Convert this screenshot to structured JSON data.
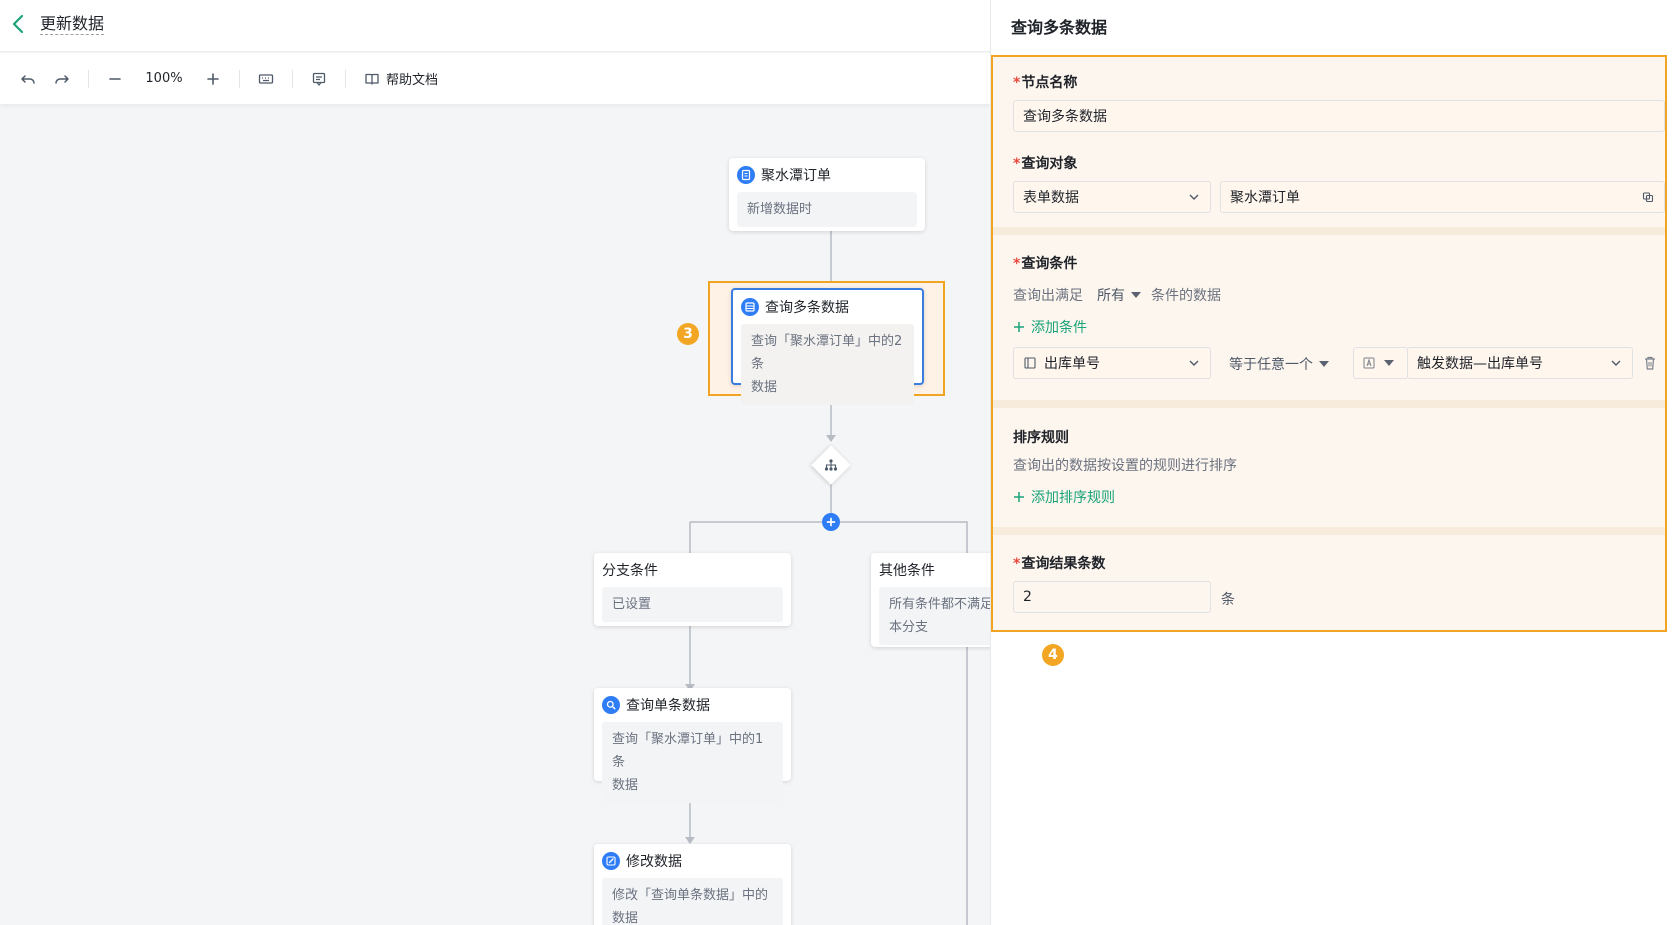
{
  "header": {
    "title": "更新数据"
  },
  "toolbar": {
    "zoom": "100%",
    "help_label": "帮助文档"
  },
  "colors": {
    "accent_blue": "#2f7df6",
    "highlight_orange": "#f0a422",
    "link_green": "#1aa37a",
    "required_red": "#e8463a"
  },
  "canvas": {
    "trigger_node": {
      "title": "聚水潭订单",
      "desc": "新增数据时"
    },
    "query_multi_node": {
      "title": "查询多条数据",
      "desc_line1": "查询「聚水潭订单」中的2条",
      "desc_line2": "数据"
    },
    "marker_3": "3",
    "branch_node": {
      "title": "分支条件",
      "desc": "已设置"
    },
    "else_node": {
      "title": "其他条件",
      "desc_line1": "所有条件都不满足",
      "desc_line2": "本分支"
    },
    "query_single_node": {
      "title": "查询单条数据",
      "desc_line1": "查询「聚水潭订单」中的1条",
      "desc_line2": "数据"
    },
    "update_node": {
      "title": "修改数据",
      "desc_line1": "修改「查询单条数据」中的",
      "desc_line2": "数据"
    }
  },
  "panel": {
    "title": "查询多条数据",
    "marker_4": "4",
    "node_name": {
      "label": "节点名称",
      "value": "查询多条数据"
    },
    "query_target": {
      "label": "查询对象",
      "type_value": "表单数据",
      "form_value": "聚水潭订单"
    },
    "query_condition": {
      "label": "查询条件",
      "prefix": "查询出满足",
      "mode": "所有",
      "suffix": "条件的数据",
      "add_label": "添加条件",
      "field": "出库单号",
      "operator": "等于任意一个",
      "value": "触发数据—出库单号"
    },
    "sort_rule": {
      "label": "排序规则",
      "hint": "查询出的数据按设置的规则进行排序",
      "add_label": "添加排序规则"
    },
    "result_count": {
      "label": "查询结果条数",
      "value": "2",
      "unit": "条"
    }
  }
}
